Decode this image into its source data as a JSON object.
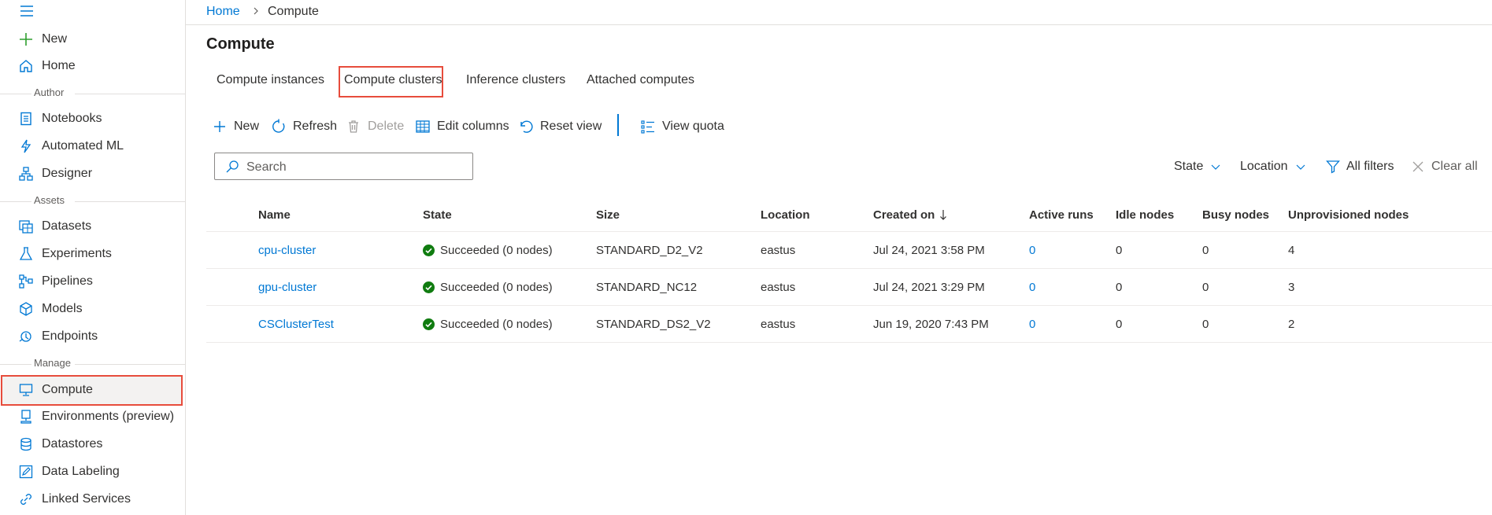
{
  "breadcrumb": {
    "home": "Home",
    "current": "Compute"
  },
  "page_title": "Compute",
  "sidebar": {
    "items_top": [
      {
        "label": "New",
        "icon": "plus-icon"
      },
      {
        "label": "Home",
        "icon": "home-icon"
      }
    ],
    "sections": [
      {
        "heading": "Author",
        "items": [
          {
            "label": "Notebooks",
            "icon": "notebook-icon"
          },
          {
            "label": "Automated ML",
            "icon": "automl-icon"
          },
          {
            "label": "Designer",
            "icon": "designer-icon"
          }
        ]
      },
      {
        "heading": "Assets",
        "items": [
          {
            "label": "Datasets",
            "icon": "dataset-icon"
          },
          {
            "label": "Experiments",
            "icon": "flask-icon"
          },
          {
            "label": "Pipelines",
            "icon": "pipeline-icon"
          },
          {
            "label": "Models",
            "icon": "cube-icon"
          },
          {
            "label": "Endpoints",
            "icon": "endpoint-icon"
          }
        ]
      },
      {
        "heading": "Manage",
        "items": [
          {
            "label": "Compute",
            "icon": "monitor-icon",
            "selected": true
          },
          {
            "label": "Environments (preview)",
            "icon": "environment-icon"
          },
          {
            "label": "Datastores",
            "icon": "database-icon"
          },
          {
            "label": "Data Labeling",
            "icon": "edit-icon"
          },
          {
            "label": "Linked Services",
            "icon": "link-icon"
          }
        ]
      }
    ]
  },
  "tabs": [
    {
      "label": "Compute instances"
    },
    {
      "label": "Compute clusters",
      "active": true
    },
    {
      "label": "Inference clusters"
    },
    {
      "label": "Attached computes"
    }
  ],
  "toolbar": {
    "new": "New",
    "refresh": "Refresh",
    "delete": "Delete",
    "edit_columns": "Edit columns",
    "reset_view": "Reset view",
    "view_quota": "View quota"
  },
  "search": {
    "placeholder": "Search",
    "value": ""
  },
  "filters": {
    "state": "State",
    "location": "Location",
    "all_filters": "All filters",
    "clear_all": "Clear all"
  },
  "table": {
    "columns": [
      "Name",
      "State",
      "Size",
      "Location",
      "Created on",
      "Active runs",
      "Idle nodes",
      "Busy nodes",
      "Unprovisioned nodes"
    ],
    "rows": [
      {
        "name": "cpu-cluster",
        "state": "Succeeded (0 nodes)",
        "size": "STANDARD_D2_V2",
        "location": "eastus",
        "created": "Jul 24, 2021 3:58 PM",
        "active_runs": "0",
        "idle": "0",
        "busy": "0",
        "unprovisioned": "4"
      },
      {
        "name": "gpu-cluster",
        "state": "Succeeded (0 nodes)",
        "size": "STANDARD_NC12",
        "location": "eastus",
        "created": "Jul 24, 2021 3:29 PM",
        "active_runs": "0",
        "idle": "0",
        "busy": "0",
        "unprovisioned": "3"
      },
      {
        "name": "CSClusterTest",
        "state": "Succeeded (0 nodes)",
        "size": "STANDARD_DS2_V2",
        "location": "eastus",
        "created": "Jun 19, 2020 7:43 PM",
        "active_runs": "0",
        "idle": "0",
        "busy": "0",
        "unprovisioned": "2"
      }
    ]
  },
  "colors": {
    "accent": "#0078d4",
    "success": "#107c10",
    "highlight": "#e74c3c"
  }
}
